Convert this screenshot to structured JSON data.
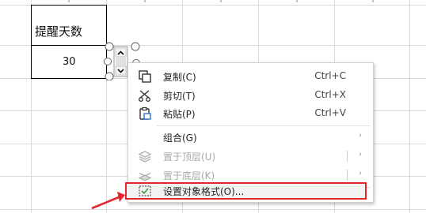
{
  "sheet": {
    "header_cell_label": "提醒天数",
    "value_cell": "30"
  },
  "spinner": {
    "up_glyph": "⌃",
    "down_glyph": "⌄"
  },
  "context_menu": {
    "items": [
      {
        "label": "复制(C)",
        "shortcut": "Ctrl+C",
        "icon": "copy-icon"
      },
      {
        "label": "剪切(T)",
        "shortcut": "Ctrl+X",
        "icon": "cut-icon"
      },
      {
        "label": "粘贴(P)",
        "shortcut": "Ctrl+V",
        "icon": "paste-icon"
      },
      {
        "label": "组合(G)",
        "submenu": "›"
      },
      {
        "label": "置于顶层(U)",
        "submenu": "›",
        "icon": "bring-to-front-icon"
      },
      {
        "label": "置于底层(K)",
        "submenu": "›",
        "icon": "send-to-back-icon"
      },
      {
        "label": "设置对象格式(O)...",
        "icon": "format-object-icon"
      }
    ]
  },
  "colors": {
    "highlight_border": "#e2262b",
    "arrow": "#e2262b"
  }
}
